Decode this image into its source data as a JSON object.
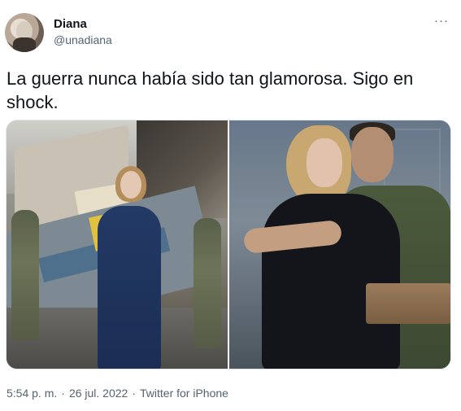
{
  "user": {
    "display_name": "Diana",
    "handle": "@unadiana"
  },
  "more_icon": "more-horizontal-icon",
  "more_glyph": "···",
  "tweet": {
    "text": "La guerra nunca había sido tan glamorosa. Sigo en shock."
  },
  "meta": {
    "time": "5:54 p. m.",
    "separator": "·",
    "date": "26 jul. 2022",
    "source": "Twitter for iPhone"
  },
  "colors": {
    "text": "#0f1419",
    "secondary": "#536471",
    "border": "#e1e8ed"
  }
}
